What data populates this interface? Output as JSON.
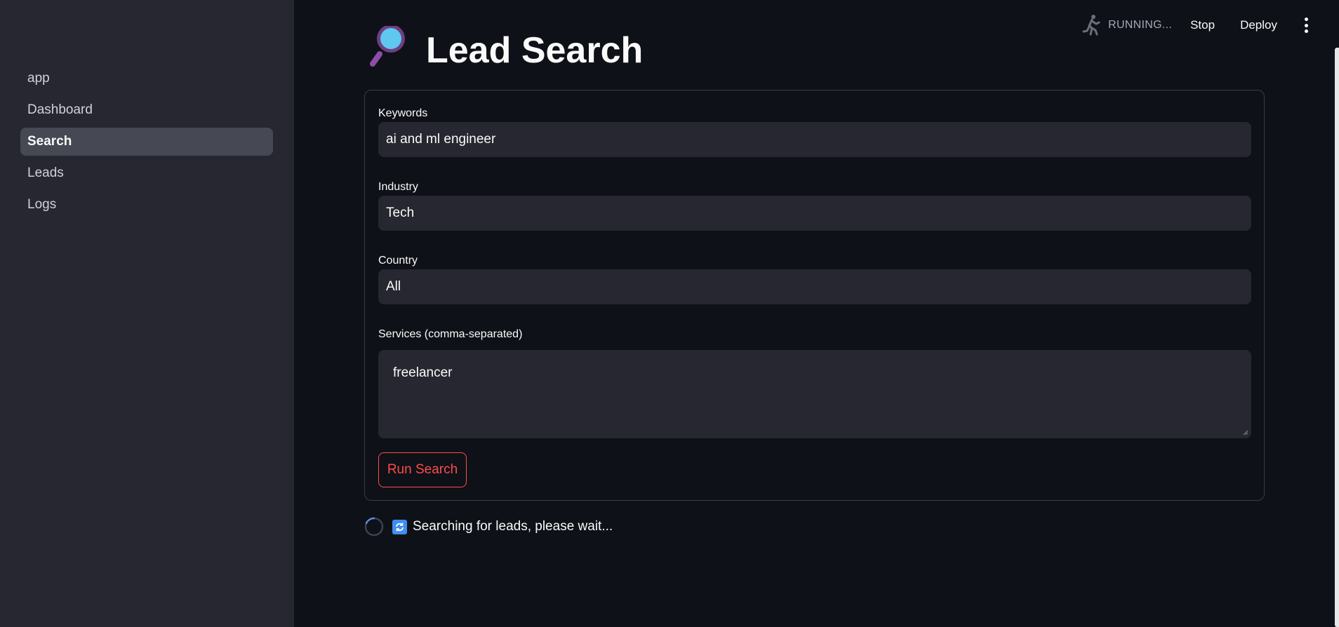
{
  "sidebar": {
    "items": [
      {
        "label": "app"
      },
      {
        "label": "Dashboard"
      },
      {
        "label": "Search",
        "active": true
      },
      {
        "label": "Leads"
      },
      {
        "label": "Logs"
      }
    ]
  },
  "toolbar": {
    "status_icon": "running-man-icon",
    "status_text": "RUNNING...",
    "stop_label": "Stop",
    "deploy_label": "Deploy",
    "menu_icon": "vertical-dots-icon"
  },
  "page": {
    "title_icon": "magnifying-glass-icon",
    "title": "Lead Search"
  },
  "form": {
    "keywords": {
      "label": "Keywords",
      "value": "ai and ml engineer"
    },
    "industry": {
      "label": "Industry",
      "value": "Tech"
    },
    "country": {
      "label": "Country",
      "value": "All"
    },
    "services": {
      "label": "Services (comma-separated)",
      "value": "freelancer"
    },
    "submit_label": "Run Search"
  },
  "status": {
    "icon": "refresh-icon",
    "message": "Searching for leads, please wait..."
  },
  "colors": {
    "background": "#0e1117",
    "sidebar": "#262730",
    "accent": "#ff4b4b",
    "input_bg": "#262730"
  }
}
